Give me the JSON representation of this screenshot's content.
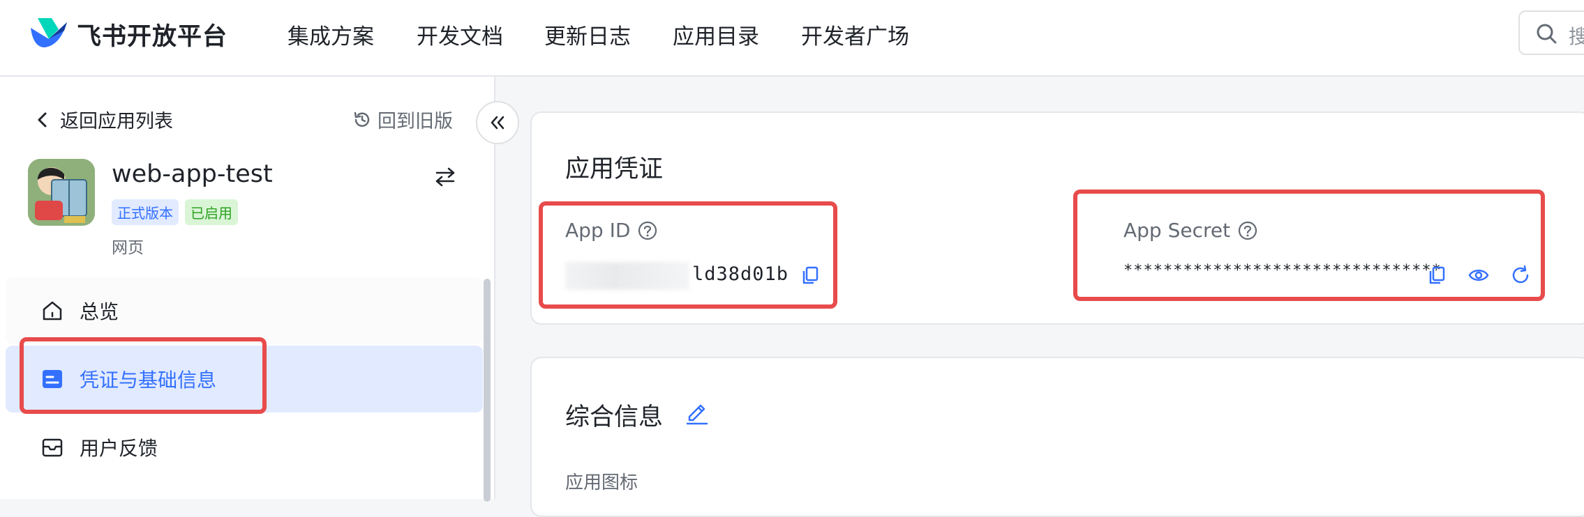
{
  "brand": {
    "name": "飞书开放平台"
  },
  "nav": {
    "items": [
      {
        "label": "集成方案"
      },
      {
        "label": "开发文档"
      },
      {
        "label": "更新日志"
      },
      {
        "label": "应用目录"
      },
      {
        "label": "开发者广场"
      }
    ]
  },
  "search": {
    "placeholder": "搜"
  },
  "sidebar": {
    "back_label": "返回应用列表",
    "old_version_label": "回到旧版",
    "app": {
      "name": "web-app-test",
      "version_badge": "正式版本",
      "status_badge": "已启用",
      "type": "网页"
    },
    "menu": [
      {
        "label": "总览",
        "icon": "home-icon"
      },
      {
        "label": "凭证与基础信息",
        "icon": "id-card-icon",
        "active": true
      },
      {
        "label": "用户反馈",
        "icon": "inbox-icon"
      }
    ]
  },
  "credentials": {
    "title": "应用凭证",
    "app_id": {
      "label": "App ID",
      "value_visible": "ld38d01b"
    },
    "app_secret": {
      "label": "App Secret",
      "value": "********************************"
    }
  },
  "info": {
    "title": "综合信息",
    "icon_label": "应用图标"
  },
  "colors": {
    "accent": "#3370ff",
    "highlight": "#e84b4b",
    "active_bg": "#e1eaff"
  }
}
